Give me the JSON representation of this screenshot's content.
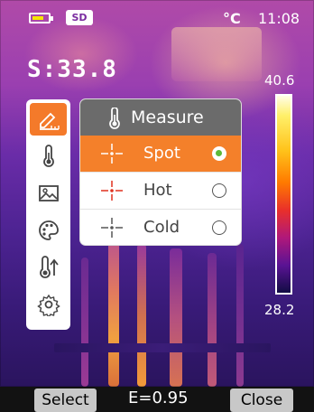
{
  "status_bar": {
    "battery_icon": "battery-icon",
    "battery_level": 0.75,
    "sd_label": "SD",
    "unit": "°C",
    "time": "11:08"
  },
  "spot_reading": "S:33.8",
  "color_scale": {
    "max": "40.6",
    "min": "28.2"
  },
  "side_menu": {
    "items": [
      {
        "icon": "measure-icon",
        "active": true
      },
      {
        "icon": "thermometer-icon",
        "active": false
      },
      {
        "icon": "image-icon",
        "active": false
      },
      {
        "icon": "palette-icon",
        "active": false
      },
      {
        "icon": "thermometer-up-icon",
        "active": false
      },
      {
        "icon": "gear-icon",
        "active": false
      }
    ]
  },
  "measure_menu": {
    "title": "Measure",
    "title_icon": "thermometer-icon",
    "options": [
      {
        "label": "Spot",
        "selected": true
      },
      {
        "label": "Hot",
        "selected": false
      },
      {
        "label": "Cold",
        "selected": false
      }
    ]
  },
  "bottom_bar": {
    "select_label": "Select",
    "emissivity": "E=0.95",
    "close_label": "Close"
  },
  "colors": {
    "accent": "#f47a2a",
    "radio_selected": "#5db93a",
    "header_gray": "#6b6b6b",
    "hot_crosshair": "#e0301e",
    "scale_stops": [
      "#fffde8",
      "#fff06a",
      "#ffc21a",
      "#ff7a00",
      "#e9302a",
      "#b0187a",
      "#5a1394",
      "#120c44"
    ]
  }
}
